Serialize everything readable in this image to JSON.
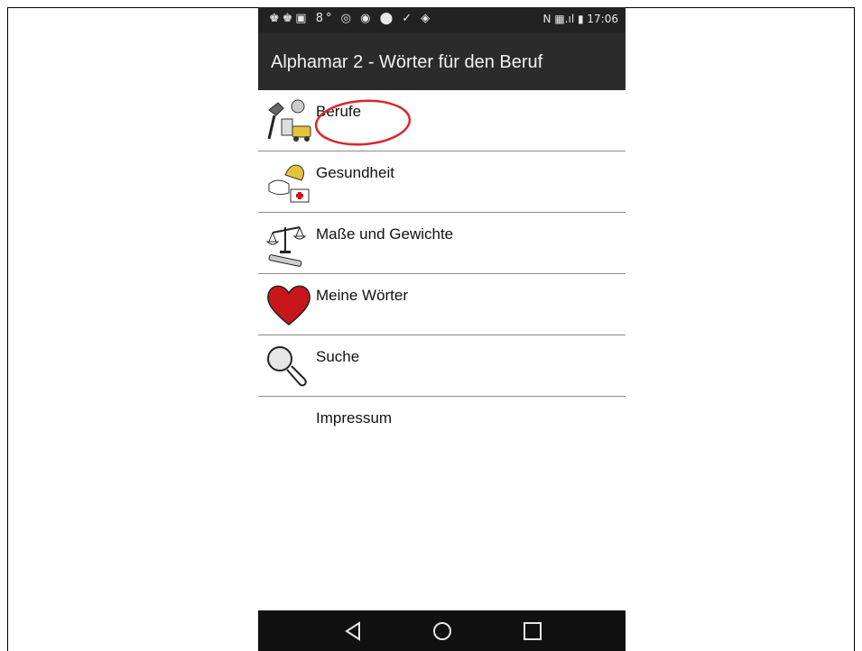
{
  "status_bar": {
    "left_icons": "♚♚▣ 8° ◎ ◉ ⬤ ✓ ◈",
    "right_icons": "N ▦.ıl ▮",
    "time": "17:06"
  },
  "app_bar": {
    "title": "Alphamar 2 - Wörter für den Beruf"
  },
  "menu": {
    "items": [
      {
        "label": "Berufe",
        "icon": "professions-icon"
      },
      {
        "label": "Gesundheit",
        "icon": "health-icon"
      },
      {
        "label": "Maße und Gewichte",
        "icon": "scale-icon"
      },
      {
        "label": "Meine Wörter",
        "icon": "heart-icon"
      },
      {
        "label": "Suche",
        "icon": "magnifier-icon"
      },
      {
        "label": "Impressum",
        "icon": ""
      }
    ]
  },
  "annotation": {
    "color": "#d9262b"
  },
  "colors": {
    "status_bar": "#222222",
    "app_bar": "#2b2b2b",
    "nav_bar": "#111111",
    "heart": "#c8161d"
  }
}
